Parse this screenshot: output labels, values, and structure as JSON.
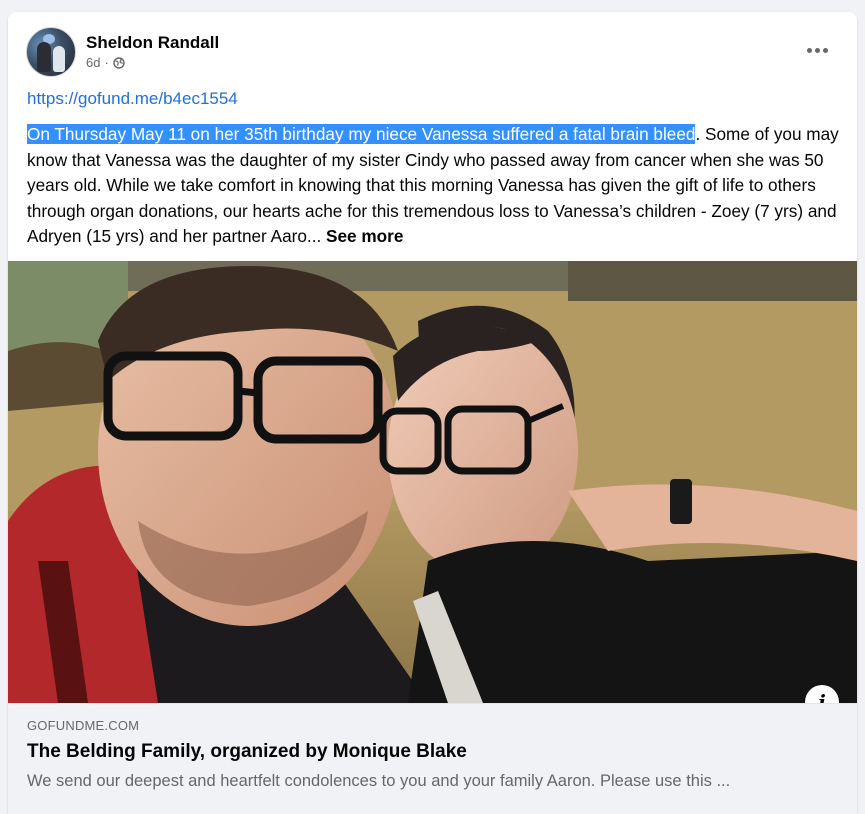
{
  "post": {
    "author": "Sheldon Randall",
    "time": "6d",
    "separator": "·",
    "privacy_icon": "globe-icon",
    "link_text": "https://gofund.me/b4ec1554",
    "highlighted_text": "On Thursday May 11 on her 35th birthday my niece Vanessa suffered a fatal brain bleed",
    "body_text": ". Some of you may know that Vanessa was the daughter of my sister Cindy who passed away from cancer when she was 50 years old.  While we take comfort in knowing that this morning Vanessa has given the gift of life to others through organ donations, our hearts ache for this tremendous loss to Vanessa’s children - Zoey (7 yrs) and Adryen (15 yrs) and her partner Aaro... ",
    "see_more": "See more"
  },
  "photo": {
    "info_icon_label": "i"
  },
  "preview": {
    "domain": "GOFUNDME.COM",
    "title": "The Belding Family, organized by Monique Blake",
    "description": "We send our deepest and heartfelt condolences to you and your family Aaron. Please use this ..."
  },
  "colors": {
    "link": "#216fdb",
    "highlight": "#3390ff",
    "muted": "#65676b"
  }
}
